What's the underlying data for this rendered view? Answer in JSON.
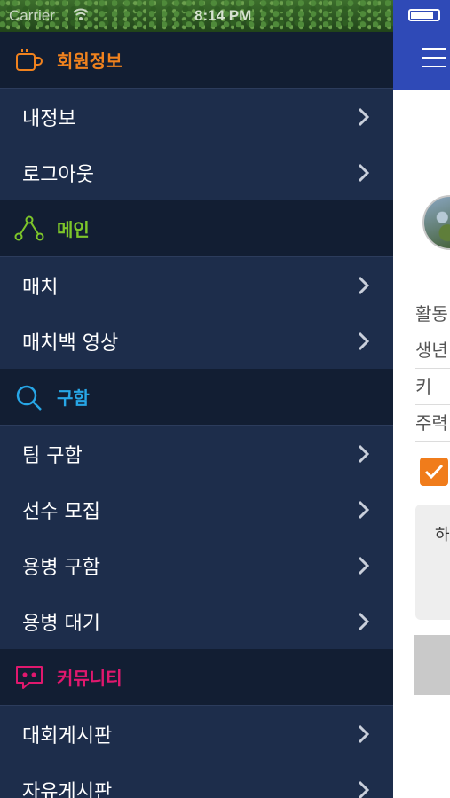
{
  "status_bar": {
    "carrier": "Carrier",
    "time": "8:14 PM"
  },
  "drawer": {
    "sections": [
      {
        "title": "회원정보",
        "icon": "coffee-cup-icon",
        "color": "#f0821e",
        "items": [
          {
            "label": "내정보"
          },
          {
            "label": "로그아웃"
          }
        ]
      },
      {
        "title": "메인",
        "icon": "network-nodes-icon",
        "color": "#7dc62a",
        "items": [
          {
            "label": "매치"
          },
          {
            "label": "매치백 영상"
          }
        ]
      },
      {
        "title": "구함",
        "icon": "search-icon",
        "color": "#27a6e6",
        "items": [
          {
            "label": "팀 구함"
          },
          {
            "label": "선수 모집"
          },
          {
            "label": "용병 구함"
          },
          {
            "label": "용병 대기"
          }
        ]
      },
      {
        "title": "커뮤니티",
        "icon": "chat-bubble-icon",
        "color": "#e0186e",
        "items": [
          {
            "label": "대회게시판"
          },
          {
            "label": "자유게시판"
          }
        ]
      }
    ]
  },
  "content": {
    "info_rows": [
      "활동",
      "생년",
      "키",
      "주력"
    ],
    "box_text": "하"
  },
  "colors": {
    "nav_blue": "#2f4ab7",
    "drawer_bg": "#1d2d4b",
    "header_bg": "#121e33",
    "checkbox_orange": "#f07c1b"
  }
}
